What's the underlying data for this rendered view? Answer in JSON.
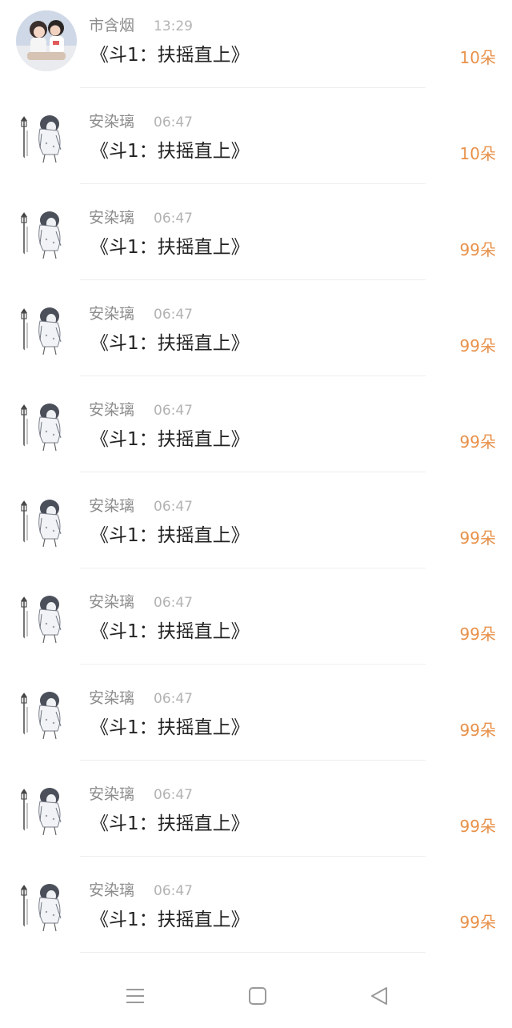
{
  "messages": [
    {
      "sender": "市含烟",
      "time": "13:29",
      "title": "《斗1：扶摇直上》",
      "amount": "10朵",
      "avatar": "couple-photo"
    },
    {
      "sender": "安染璃",
      "time": "06:47",
      "title": "《斗1：扶摇直上》",
      "amount": "10朵",
      "avatar": "sketch-girl"
    },
    {
      "sender": "安染璃",
      "time": "06:47",
      "title": "《斗1：扶摇直上》",
      "amount": "99朵",
      "avatar": "sketch-girl"
    },
    {
      "sender": "安染璃",
      "time": "06:47",
      "title": "《斗1：扶摇直上》",
      "amount": "99朵",
      "avatar": "sketch-girl"
    },
    {
      "sender": "安染璃",
      "time": "06:47",
      "title": "《斗1：扶摇直上》",
      "amount": "99朵",
      "avatar": "sketch-girl"
    },
    {
      "sender": "安染璃",
      "time": "06:47",
      "title": "《斗1：扶摇直上》",
      "amount": "99朵",
      "avatar": "sketch-girl"
    },
    {
      "sender": "安染璃",
      "time": "06:47",
      "title": "《斗1：扶摇直上》",
      "amount": "99朵",
      "avatar": "sketch-girl"
    },
    {
      "sender": "安染璃",
      "time": "06:47",
      "title": "《斗1：扶摇直上》",
      "amount": "99朵",
      "avatar": "sketch-girl"
    },
    {
      "sender": "安染璃",
      "time": "06:47",
      "title": "《斗1：扶摇直上》",
      "amount": "99朵",
      "avatar": "sketch-girl"
    },
    {
      "sender": "安染璃",
      "time": "06:47",
      "title": "《斗1：扶摇直上》",
      "amount": "99朵",
      "avatar": "sketch-girl"
    }
  ],
  "navbar": {
    "buttons": [
      "menu-icon",
      "home-square-icon",
      "back-triangle-icon"
    ]
  },
  "colors": {
    "amount": "#e8914a",
    "sender": "#8c8c8c",
    "time": "#b3b3b3",
    "title": "#222222",
    "divider": "#eeeeee"
  }
}
